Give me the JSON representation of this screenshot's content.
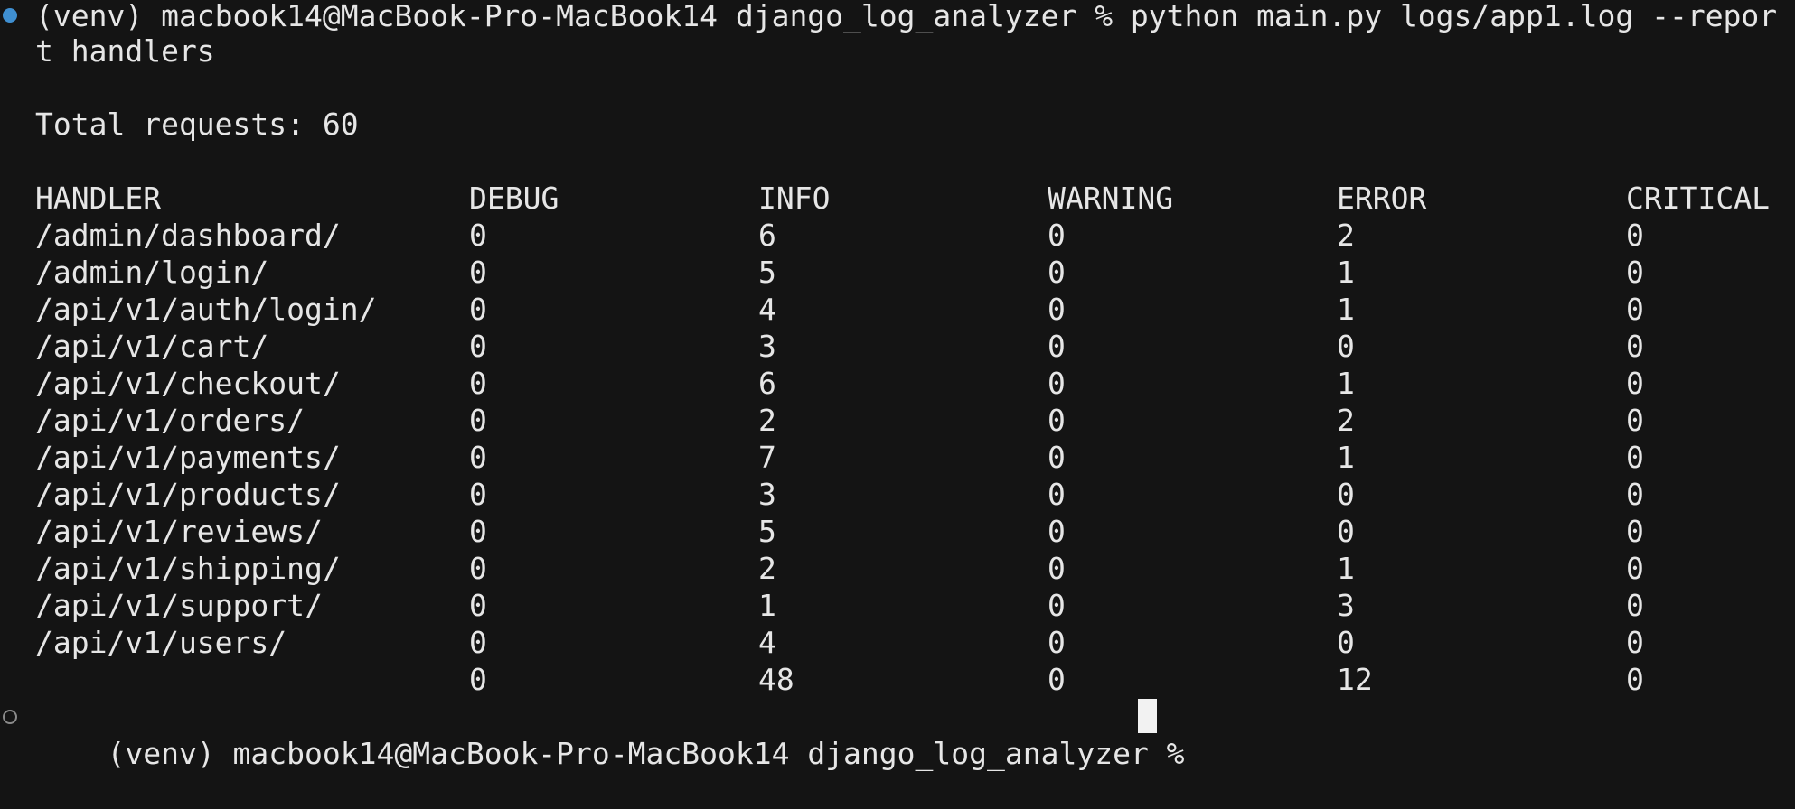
{
  "prompt": {
    "text": "(venv) macbook14@MacBook-Pro-MacBook14 django_log_analyzer %",
    "command": "python main.py logs/app1.log --report handlers",
    "first_line": "(venv) macbook14@MacBook-Pro-MacBook14 django_log_analyzer % python main.py logs/app1.log --repor",
    "wrap_line": "t handlers"
  },
  "summary": {
    "total_requests": "Total requests: 60"
  },
  "table": {
    "headers": [
      "HANDLER",
      "DEBUG",
      "INFO",
      "WARNING",
      "ERROR",
      "CRITICAL"
    ],
    "rows": [
      [
        "/admin/dashboard/",
        "0",
        "6",
        "0",
        "2",
        "0"
      ],
      [
        "/admin/login/",
        "0",
        "5",
        "0",
        "1",
        "0"
      ],
      [
        "/api/v1/auth/login/",
        "0",
        "4",
        "0",
        "1",
        "0"
      ],
      [
        "/api/v1/cart/",
        "0",
        "3",
        "0",
        "0",
        "0"
      ],
      [
        "/api/v1/checkout/",
        "0",
        "6",
        "0",
        "1",
        "0"
      ],
      [
        "/api/v1/orders/",
        "0",
        "2",
        "0",
        "2",
        "0"
      ],
      [
        "/api/v1/payments/",
        "0",
        "7",
        "0",
        "1",
        "0"
      ],
      [
        "/api/v1/products/",
        "0",
        "3",
        "0",
        "0",
        "0"
      ],
      [
        "/api/v1/reviews/",
        "0",
        "5",
        "0",
        "0",
        "0"
      ],
      [
        "/api/v1/shipping/",
        "0",
        "2",
        "0",
        "1",
        "0"
      ],
      [
        "/api/v1/support/",
        "0",
        "1",
        "0",
        "3",
        "0"
      ],
      [
        "/api/v1/users/",
        "0",
        "4",
        "0",
        "0",
        "0"
      ]
    ],
    "totals": [
      "",
      "0",
      "48",
      "0",
      "12",
      "0"
    ]
  },
  "next_prompt": {
    "text": "(venv) macbook14@MacBook-Pro-MacBook14 django_log_analyzer % "
  },
  "colors": {
    "background": "#141414",
    "foreground": "#e6e6e6",
    "marker_success": "#3f8fd1",
    "marker_idle": "#8a8a8a",
    "cursor": "#f2f2f2"
  },
  "icons": {
    "command_marker": "filled-circle-icon",
    "prompt_marker": "hollow-circle-icon"
  }
}
